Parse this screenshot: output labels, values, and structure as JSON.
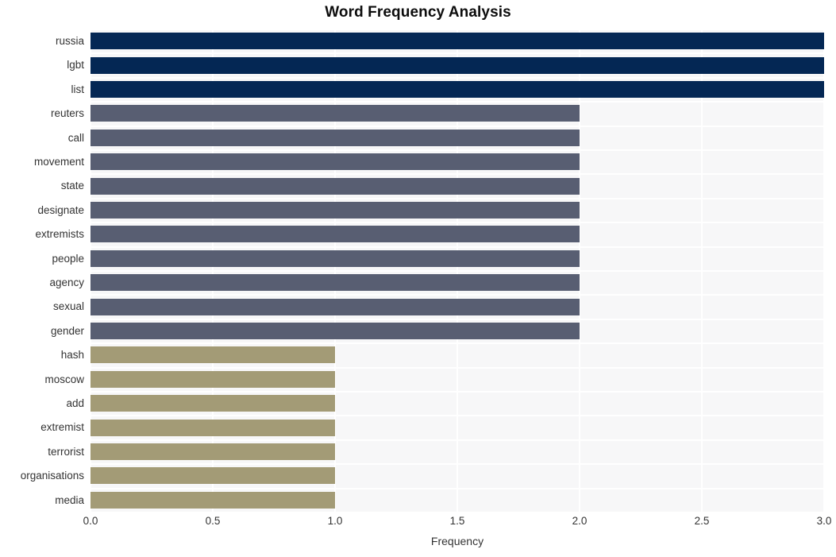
{
  "chart_data": {
    "type": "bar",
    "orientation": "horizontal",
    "title": "Word Frequency Analysis",
    "xlabel": "Frequency",
    "ylabel": "",
    "xlim": [
      0.0,
      3.0
    ],
    "xticks": [
      "0.0",
      "0.5",
      "1.0",
      "1.5",
      "2.0",
      "2.5",
      "3.0"
    ],
    "xtick_values": [
      0.0,
      0.5,
      1.0,
      1.5,
      2.0,
      2.5,
      3.0
    ],
    "grid": true,
    "grid_color": "#ffffff",
    "plot_background": "#f7f7f8",
    "legend": null,
    "categories": [
      "russia",
      "lgbt",
      "list",
      "reuters",
      "call",
      "movement",
      "state",
      "designate",
      "extremists",
      "people",
      "agency",
      "sexual",
      "gender",
      "hash",
      "moscow",
      "add",
      "extremist",
      "terrorist",
      "organisations",
      "media"
    ],
    "values": [
      3,
      3,
      3,
      2,
      2,
      2,
      2,
      2,
      2,
      2,
      2,
      2,
      2,
      1,
      1,
      1,
      1,
      1,
      1,
      1
    ],
    "bar_colors": [
      "#042754",
      "#042754",
      "#042754",
      "#585e72",
      "#585e72",
      "#585e72",
      "#585e72",
      "#585e72",
      "#585e72",
      "#585e72",
      "#585e72",
      "#585e72",
      "#585e72",
      "#a39b76",
      "#a39b76",
      "#a39b76",
      "#a39b76",
      "#a39b76",
      "#a39b76",
      "#a39b76"
    ],
    "palette": {
      "high": "#042754",
      "mid": "#585e72",
      "low": "#a39b76"
    }
  }
}
